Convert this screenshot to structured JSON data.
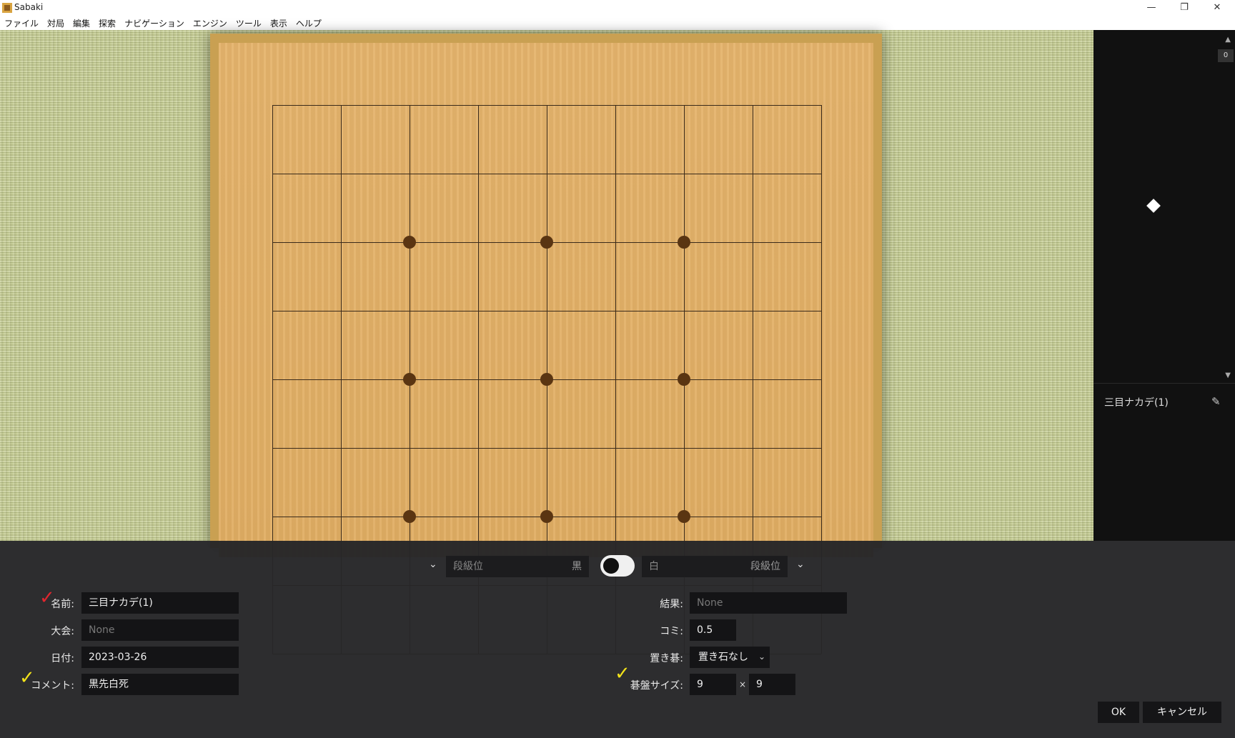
{
  "window": {
    "title": "Sabaki",
    "minimize": "—",
    "restore": "❐",
    "close": "✕"
  },
  "menu": [
    "ファイル",
    "対局",
    "編集",
    "探索",
    "ナビゲーション",
    "エンジン",
    "ツール",
    "表示",
    "ヘルプ"
  ],
  "board": {
    "size": 9,
    "star_points": [
      [
        2,
        2
      ],
      [
        4,
        2
      ],
      [
        6,
        2
      ],
      [
        2,
        4
      ],
      [
        4,
        4
      ],
      [
        6,
        4
      ],
      [
        2,
        6
      ],
      [
        4,
        6
      ],
      [
        6,
        6
      ]
    ]
  },
  "sidebar": {
    "move_number": "0",
    "scroll_up": "▲",
    "scroll_down": "▼",
    "comment_title": "三目ナカデ(1)",
    "edit_icon": "✎"
  },
  "info": {
    "black_rank_placeholder": "段級位",
    "black_name_label": "黒",
    "white_name_label": "白",
    "white_rank_placeholder": "段級位",
    "chevron": "⌄",
    "labels": {
      "name": "名前:",
      "event": "大会:",
      "date": "日付:",
      "comment": "コメント:",
      "result": "結果:",
      "komi": "コミ:",
      "handicap": "置き碁:",
      "board_size": "碁盤サイズ:"
    },
    "values": {
      "name": "三目ナカデ(1)",
      "event_placeholder": "None",
      "date": "2023-03-26",
      "comment": "黒先白死",
      "result_placeholder": "None",
      "komi": "0.5",
      "handicap": "置き石なし",
      "board_width": "9",
      "board_height": "9",
      "times": "×"
    },
    "marks": {
      "check": "✓",
      "red": "#e0262e",
      "yellow": "#f2e21a"
    },
    "buttons": {
      "ok": "OK",
      "cancel": "キャンセル"
    }
  }
}
